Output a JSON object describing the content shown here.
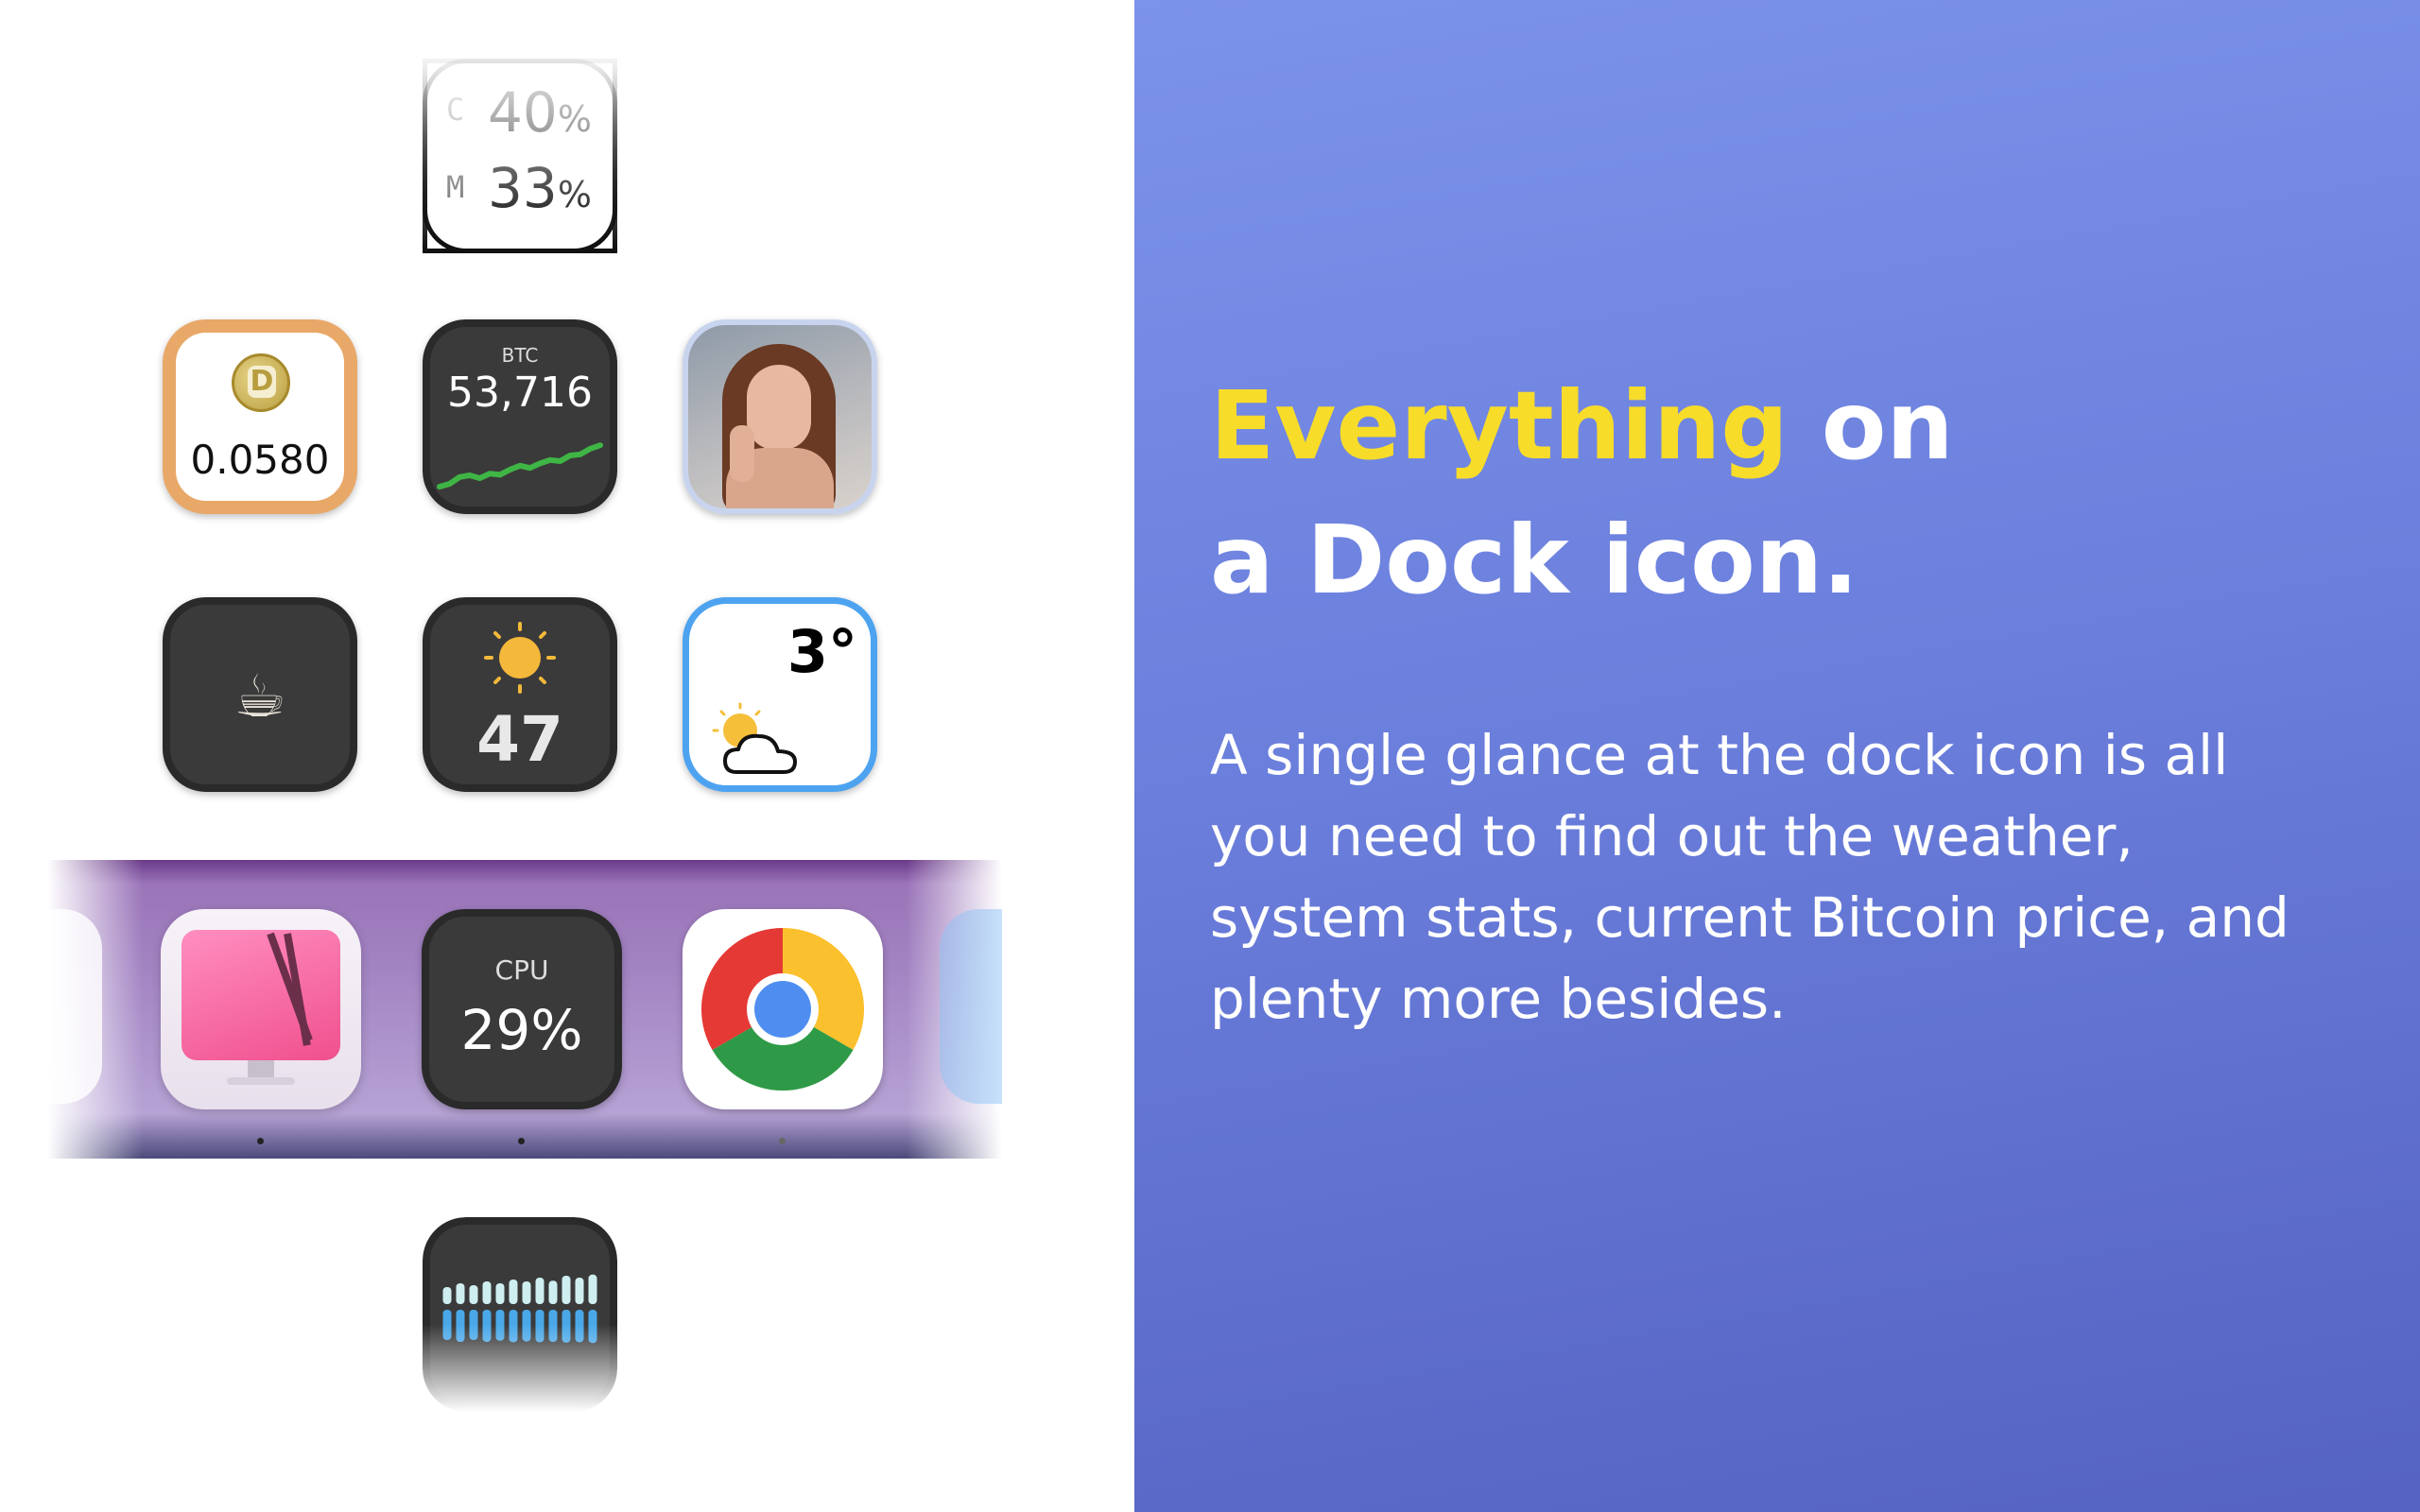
{
  "memory_icon": {
    "c_label": "C",
    "c_value": "40",
    "m_label": "M",
    "m_value": "33",
    "unit": "%"
  },
  "dogecoin_icon": {
    "price": "0.0580",
    "color": "#e8a868"
  },
  "btc_icon": {
    "label": "BTC",
    "price": "53,716",
    "spark": [
      0.15,
      0.2,
      0.32,
      0.35,
      0.3,
      0.38,
      0.36,
      0.45,
      0.52,
      0.48,
      0.56,
      0.62,
      0.6,
      0.7,
      0.72,
      0.82,
      0.88
    ]
  },
  "photo_icon": {
    "icon": "portrait-photo"
  },
  "coffee_icon": {
    "glyph": "☕"
  },
  "sun_temp_icon": {
    "value": "47",
    "icon": "sun-icon"
  },
  "weather_icon": {
    "temperature": "3°",
    "icon": "partly-cloudy-icon",
    "border_color": "#4da3f0"
  },
  "dock": {
    "cleanmymac_icon": "cleanmymac-icon",
    "cpu_icon": {
      "label": "CPU",
      "value": "29%"
    },
    "chrome_icon": "chrome-icon"
  },
  "audio_icon": {
    "top_bars": [
      0.45,
      0.55,
      0.5,
      0.6,
      0.55,
      0.65,
      0.6,
      0.7,
      0.62,
      0.75,
      0.7,
      0.78
    ],
    "bottom_bars": [
      0.8,
      0.85,
      0.8,
      0.85,
      0.82,
      0.86,
      0.84,
      0.86,
      0.85,
      0.87,
      0.86,
      0.88
    ]
  },
  "headline": {
    "accent": "Everything",
    "line1_rest": " on",
    "line2": "a Dock icon."
  },
  "description": "A single glance at the dock icon is all you need to find out the weather, system stats, current Bitcoin price, and plenty more besides."
}
